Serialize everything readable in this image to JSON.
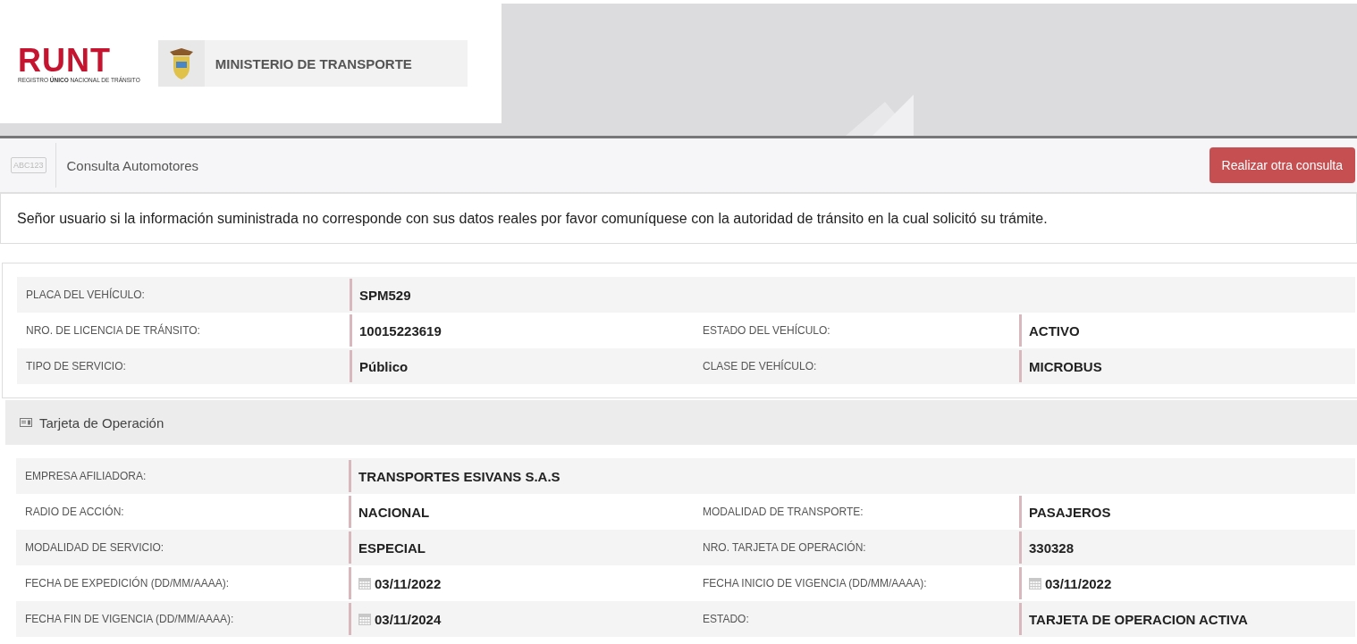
{
  "header": {
    "runt_logo": "RUNT",
    "runt_subtitle": "REGISTRO **ÚNICO** NACIONAL DE TRÁNSITO",
    "ministry": "MINISTERIO DE TRANSPORTE"
  },
  "toolbar": {
    "plate_badge": "ABC123",
    "title": "Consulta Automotores",
    "button": "Realizar otra consulta"
  },
  "notice": "Señor usuario si la información suministrada no corresponde con sus datos reales por favor comuníquese con la autoridad de tránsito en la cual solicitó su trámite.",
  "vehicle_rows": [
    [
      {
        "label": "PLACA DEL VEHÍCULO:",
        "value": "SPM529"
      }
    ],
    [
      {
        "label": "NRO. DE LICENCIA DE TRÁNSITO:",
        "value": "10015223619"
      },
      {
        "label": "ESTADO DEL VEHÍCULO:",
        "value": "ACTIVO"
      }
    ],
    [
      {
        "label": "TIPO DE SERVICIO:",
        "value": "Público"
      },
      {
        "label": "CLASE DE VEHÍCULO:",
        "value": "MICROBUS"
      }
    ]
  ],
  "operation_section": {
    "title": "Tarjeta de Operación",
    "rows": [
      [
        {
          "label": "EMPRESA AFILIADORA:",
          "value": "TRANSPORTES ESIVANS S.A.S"
        }
      ],
      [
        {
          "label": "RADIO DE ACCIÓN:",
          "value": "NACIONAL"
        },
        {
          "label": "MODALIDAD DE TRANSPORTE:",
          "value": "PASAJEROS"
        }
      ],
      [
        {
          "label": "MODALIDAD DE SERVICIO:",
          "value": "ESPECIAL"
        },
        {
          "label": "NRO. TARJETA DE OPERACIÓN:",
          "value": "330328"
        }
      ],
      [
        {
          "label": "FECHA DE EXPEDICIÓN (DD/MM/AAAA):",
          "value": "03/11/2022",
          "kind": "date"
        },
        {
          "label": "FECHA INICIO DE VIGENCIA (DD/MM/AAAA):",
          "value": "03/11/2022",
          "kind": "date"
        }
      ],
      [
        {
          "label": "FECHA FIN DE VIGENCIA (DD/MM/AAAA):",
          "value": "03/11/2024",
          "kind": "date"
        },
        {
          "label": "ESTADO:",
          "value": "TARJETA DE OPERACION ACTIVA"
        }
      ]
    ]
  }
}
